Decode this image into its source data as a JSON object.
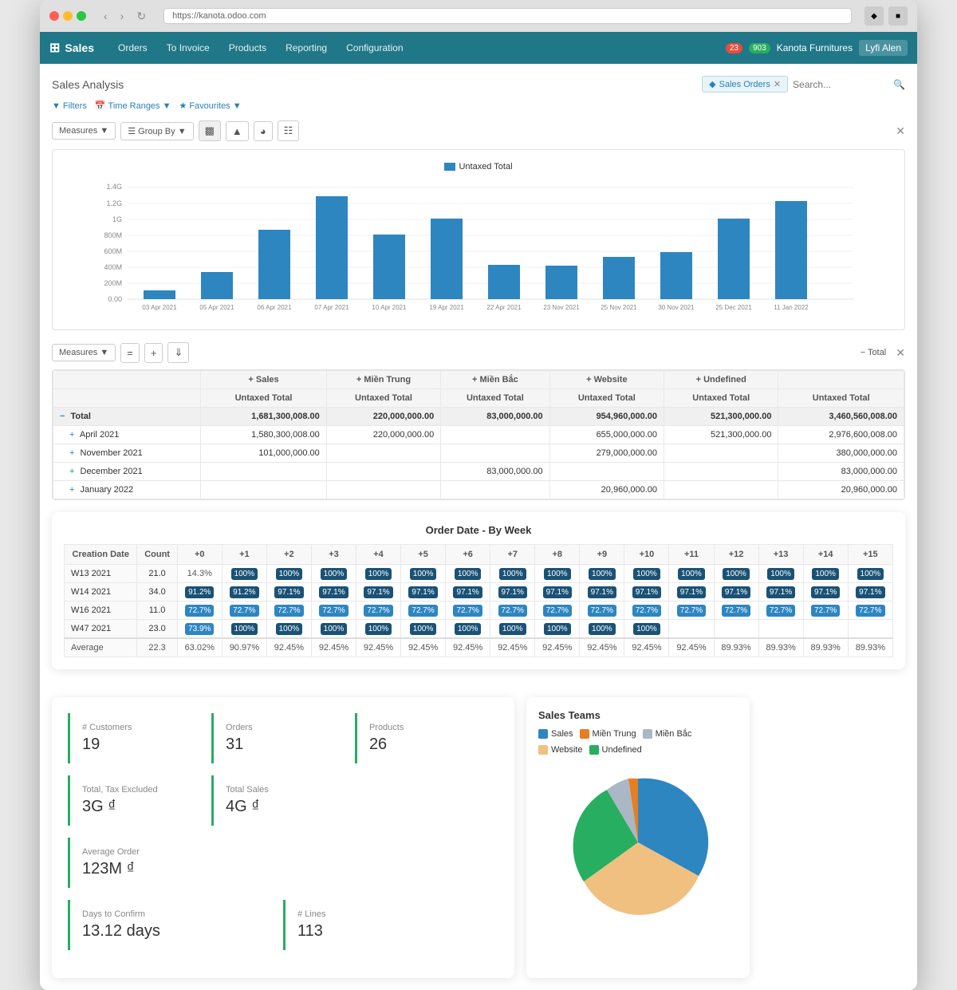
{
  "browser": {
    "url": "https://kanota.odoo.com",
    "title": "Sales Analysis"
  },
  "navbar": {
    "app_name": "Sales",
    "menu_items": [
      "Orders",
      "To Invoice",
      "Products",
      "Reporting",
      "Configuration"
    ],
    "notifications_count": "23",
    "messages_count": "903",
    "company": "Kanota Furnitures",
    "user": "Lyfi Alen"
  },
  "page": {
    "title": "Sales Analysis",
    "search_tag": "Sales Orders",
    "search_placeholder": "Search..."
  },
  "filters": {
    "items": [
      "Filters",
      "Time Ranges",
      "Favourites"
    ]
  },
  "chart": {
    "legend_label": "Untaxed Total",
    "y_labels": [
      "1.4G",
      "1.2G",
      "1G",
      "800M",
      "600M",
      "400M",
      "200M",
      "0.00"
    ],
    "bars": [
      {
        "label": "03 Apr 2021",
        "value": 0.08
      },
      {
        "label": "05 Apr 2021",
        "value": 0.24
      },
      {
        "label": "06 Apr 2021",
        "value": 0.62
      },
      {
        "label": "07 Apr 2021",
        "value": 0.92
      },
      {
        "label": "10 Apr 2021",
        "value": 0.58
      },
      {
        "label": "19 Apr 2021",
        "value": 0.72
      },
      {
        "label": "22 Apr 2021",
        "value": 0.31
      },
      {
        "label": "23 Nov 2021",
        "value": 0.3
      },
      {
        "label": "25 Nov 2021",
        "value": 0.38
      },
      {
        "label": "30 Nov 2021",
        "value": 0.42
      },
      {
        "label": "25 Dec 2021",
        "value": 0.72
      },
      {
        "label": "11 Jan 2022",
        "value": 0.88
      }
    ]
  },
  "pivot": {
    "column_headers": [
      "",
      "Sales",
      "Miền Trung",
      "Miền Bắc",
      "Website",
      "Undefined",
      ""
    ],
    "sub_headers": [
      "",
      "Untaxed Total",
      "Untaxed Total",
      "Untaxed Total",
      "Untaxed Total",
      "Untaxed Total",
      "Untaxed Total"
    ],
    "rows": [
      {
        "label": "Total",
        "type": "total",
        "values": [
          "1,681,300,008.00",
          "220,000,000.00",
          "83,000,000.00",
          "954,960,000.00",
          "521,300,000.00",
          "3,460,560,008.00"
        ]
      },
      {
        "label": "April 2021",
        "type": "sub",
        "values": [
          "1,580,300,008.00",
          "220,000,000.00",
          "",
          "655,000,000.00",
          "521,300,000.00",
          "2,976,600,008.00"
        ]
      },
      {
        "label": "November 2021",
        "type": "sub",
        "values": [
          "101,000,000.00",
          "",
          "",
          "279,000,000.00",
          "",
          "380,000,000.00"
        ]
      },
      {
        "label": "December 2021",
        "type": "sub",
        "values": [
          "",
          "",
          "83,000,000.00",
          "",
          "",
          "83,000,000.00"
        ]
      },
      {
        "label": "January 2022",
        "type": "sub",
        "values": [
          "",
          "",
          "",
          "20,960,000.00",
          "",
          "20,960,000.00"
        ]
      }
    ]
  },
  "cohort": {
    "title": "Order Date - By Week",
    "headers": [
      "Creation Date",
      "Count",
      "+0",
      "+1",
      "+2",
      "+3",
      "+4",
      "+5",
      "+6",
      "+7",
      "+8",
      "+9",
      "+10",
      "+11",
      "+12",
      "+13",
      "+14",
      "+15"
    ],
    "rows": [
      {
        "period": "W13 2021",
        "count": "21.0",
        "cells": [
          "14.3%",
          "100%",
          "100%",
          "100%",
          "100%",
          "100%",
          "100%",
          "100%",
          "100%",
          "100%",
          "100%",
          "100%",
          "100%",
          "100%",
          "100%",
          "100%"
        ],
        "types": [
          "light",
          "dark",
          "dark",
          "dark",
          "dark",
          "dark",
          "dark",
          "dark",
          "dark",
          "dark",
          "dark",
          "dark",
          "dark",
          "dark",
          "dark",
          "dark"
        ]
      },
      {
        "period": "W14 2021",
        "count": "34.0",
        "cells": [
          "91.2%",
          "91.2%",
          "97.1%",
          "97.1%",
          "97.1%",
          "97.1%",
          "97.1%",
          "97.1%",
          "97.1%",
          "97.1%",
          "97.1%",
          "97.1%",
          "97.1%",
          "97.1%",
          "97.1%",
          "97.1%"
        ],
        "types": [
          "dark",
          "dark",
          "dark",
          "dark",
          "dark",
          "dark",
          "dark",
          "dark",
          "dark",
          "dark",
          "dark",
          "dark",
          "dark",
          "dark",
          "dark",
          "dark"
        ]
      },
      {
        "period": "W16 2021",
        "count": "11.0",
        "cells": [
          "72.7%",
          "72.7%",
          "72.7%",
          "72.7%",
          "72.7%",
          "72.7%",
          "72.7%",
          "72.7%",
          "72.7%",
          "72.7%",
          "72.7%",
          "72.7%",
          "72.7%",
          "72.7%",
          "72.7%",
          "72.7%"
        ],
        "types": [
          "blue",
          "blue",
          "blue",
          "blue",
          "blue",
          "blue",
          "blue",
          "blue",
          "blue",
          "blue",
          "blue",
          "blue",
          "blue",
          "blue",
          "blue",
          "blue"
        ]
      },
      {
        "period": "W47 2021",
        "count": "23.0",
        "cells": [
          "73.9%",
          "100%",
          "100%",
          "100%",
          "100%",
          "100%",
          "100%",
          "100%",
          "100%",
          "100%",
          "100%",
          "",
          "",
          "",
          "",
          ""
        ],
        "types": [
          "blue",
          "dark",
          "dark",
          "dark",
          "dark",
          "dark",
          "dark",
          "dark",
          "dark",
          "dark",
          "dark",
          "",
          "",
          "",
          "",
          ""
        ]
      }
    ],
    "avg_row": {
      "label": "Average",
      "count": "22.3",
      "cells": [
        "63.02%",
        "90.97%",
        "92.45%",
        "92.45%",
        "92.45%",
        "92.45%",
        "92.45%",
        "92.45%",
        "92.45%",
        "92.45%",
        "92.45%",
        "92.45%",
        "89.93%",
        "89.93%",
        "89.93%",
        "89.93%"
      ]
    }
  },
  "kpis": [
    {
      "label": "# Customers",
      "value": "19"
    },
    {
      "label": "Orders",
      "value": "31"
    },
    {
      "label": "Products",
      "value": "26"
    },
    {
      "label": "Total, Tax Excluded",
      "value": "3G ₫"
    },
    {
      "label": "Total Sales",
      "value": "4G ₫"
    },
    {
      "label": "Average Order",
      "value": "123M ₫"
    },
    {
      "label": "Days to Confirm",
      "value": "13.12 days"
    },
    {
      "label": "# Lines",
      "value": "113"
    }
  ],
  "sales_teams": {
    "title": "Sales Teams",
    "legend": [
      {
        "label": "Sales",
        "color": "#2e86c1"
      },
      {
        "label": "Miền Trung",
        "color": "#e67e22"
      },
      {
        "label": "Miền Bắc",
        "color": "#aab7c4"
      },
      {
        "label": "Website",
        "color": "#f0c080"
      },
      {
        "label": "Undefined",
        "color": "#27ae60"
      }
    ]
  }
}
